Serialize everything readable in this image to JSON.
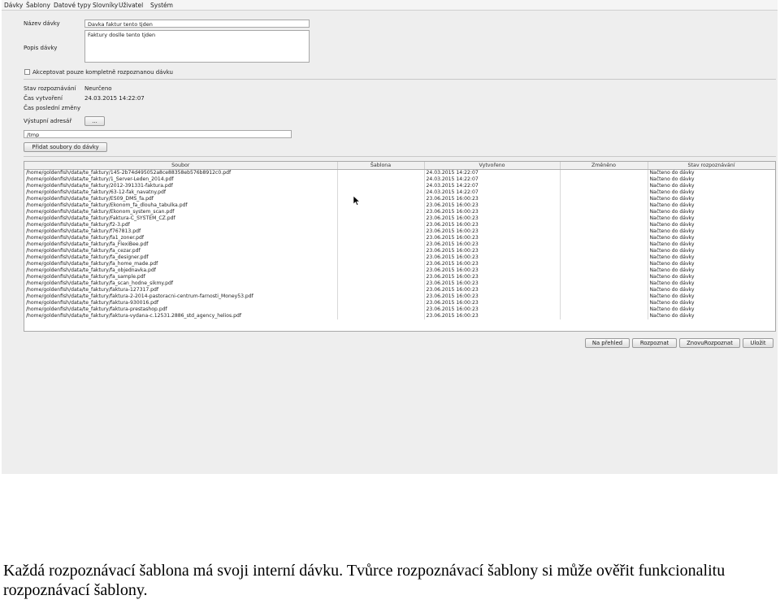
{
  "menu": [
    "Dávky",
    "Šablony",
    "Datové typy",
    "Slovníky",
    "Uživatel",
    "Systém"
  ],
  "form": {
    "name_label": "Název dávky",
    "name_value": "Davka faktur tento tjden",
    "description_label": "Popis dávky",
    "description_value": "Faktury doslle tento tjden",
    "checkbox_label": "Akceptovat pouze kompletně rozpoznanou dávku",
    "status_label": "Stav rozpoznávání",
    "status_value": "Neurčeno",
    "created_label": "Čas vytvoření",
    "created_value": "24.03.2015 14:22:07",
    "modified_label": "Čas poslední změny",
    "modified_value": "",
    "output_label": "Výstupní adresář",
    "browse_label": "...",
    "output_path": "/tmp",
    "add_files_label": "Přidat soubory do dávky"
  },
  "table": {
    "columns": [
      "Soubor",
      "Šablona",
      "Vytvořeno",
      "Změněno",
      "Stav rozpoznávání"
    ],
    "rows": [
      [
        "/home/goldenfish/data/te_faktury/145-2b74d495052a8ce88358eb576b8912c0.pdf",
        "",
        "24.03.2015 14:22:07",
        "",
        "Načteno do dávky"
      ],
      [
        "/home/goldenfish/data/te_faktury/1_Server-Leden_2014.pdf",
        "",
        "24.03.2015 14:22:07",
        "",
        "Načteno do dávky"
      ],
      [
        "/home/goldenfish/data/te_faktury/2012-391331-faktura.pdf",
        "",
        "24.03.2015 14:22:07",
        "",
        "Načteno do dávky"
      ],
      [
        "/home/goldenfish/data/te_faktury/63-12-fak_navatny.pdf",
        "",
        "24.03.2015 14:22:07",
        "",
        "Načteno do dávky"
      ],
      [
        "/home/goldenfish/data/te_faktury/ES09_DMS_fa.pdf",
        "",
        "23.06.2015 16:00:23",
        "",
        "Načteno do dávky"
      ],
      [
        "/home/goldenfish/data/te_faktury/Ekonom_fa_dlouha_tabulka.pdf",
        "",
        "23.06.2015 16:00:23",
        "",
        "Načteno do dávky"
      ],
      [
        "/home/goldenfish/data/te_faktury/Ekonom_system_scan.pdf",
        "",
        "23.06.2015 16:00:23",
        "",
        "Načteno do dávky"
      ],
      [
        "/home/goldenfish/data/te_faktury/Faktura-C_SYSTEM_CZ.pdf",
        "",
        "23.06.2015 16:00:23",
        "",
        "Načteno do dávky"
      ],
      [
        "/home/goldenfish/data/te_faktury/f2-3.pdf",
        "",
        "23.06.2015 16:00:23",
        "",
        "Načteno do dávky"
      ],
      [
        "/home/goldenfish/data/te_faktury/f767813.pdf",
        "",
        "23.06.2015 16:00:23",
        "",
        "Načteno do dávky"
      ],
      [
        "/home/goldenfish/data/te_faktury/fa1_zoner.pdf",
        "",
        "23.06.2015 16:00:23",
        "",
        "Načteno do dávky"
      ],
      [
        "/home/goldenfish/data/te_faktury/fa_FlexiBee.pdf",
        "",
        "23.06.2015 16:00:23",
        "",
        "Načteno do dávky"
      ],
      [
        "/home/goldenfish/data/te_faktury/fa_cezar.pdf",
        "",
        "23.06.2015 16:00:23",
        "",
        "Načteno do dávky"
      ],
      [
        "/home/goldenfish/data/te_faktury/fa_designer.pdf",
        "",
        "23.06.2015 16:00:23",
        "",
        "Načteno do dávky"
      ],
      [
        "/home/goldenfish/data/te_faktury/fa_home_made.pdf",
        "",
        "23.06.2015 16:00:23",
        "",
        "Načteno do dávky"
      ],
      [
        "/home/goldenfish/data/te_faktury/fa_objednavka.pdf",
        "",
        "23.06.2015 16:00:23",
        "",
        "Načteno do dávky"
      ],
      [
        "/home/goldenfish/data/te_faktury/fa_sample.pdf",
        "",
        "23.06.2015 16:00:23",
        "",
        "Načteno do dávky"
      ],
      [
        "/home/goldenfish/data/te_faktury/fa_scan_hodne_sikmy.pdf",
        "",
        "23.06.2015 16:00:23",
        "",
        "Načteno do dávky"
      ],
      [
        "/home/goldenfish/data/te_faktury/faktura-127317.pdf",
        "",
        "23.06.2015 16:00:23",
        "",
        "Načteno do dávky"
      ],
      [
        "/home/goldenfish/data/te_faktury/faktura-2-2014-pastoracni-centrum-farnosti_Money53.pdf",
        "",
        "23.06.2015 16:00:23",
        "",
        "Načteno do dávky"
      ],
      [
        "/home/goldenfish/data/te_faktury/faktura-930016.pdf",
        "",
        "23.06.2015 16:00:23",
        "",
        "Načteno do dávky"
      ],
      [
        "/home/goldenfish/data/te_faktury/faktura-prestashop.pdf",
        "",
        "23.06.2015 16:00:23",
        "",
        "Načteno do dávky"
      ],
      [
        "/home/goldenfish/data/te_faktury/faktura-vydana-c.12531.2886_std_agency_helios.pdf",
        "",
        "23.06.2015 16:00:23",
        "",
        "Načteno do dávky"
      ]
    ]
  },
  "actions": {
    "overview_label": "Na přehled",
    "recognize_label": "Rozpoznat",
    "rerecognize_label": "ZnovuRozpoznat",
    "save_label": "Uložit"
  },
  "caption": "Každá rozpoznávací šablona má svoji interní dávku. Tvůrce rozpoznávací šablony si může ověřit funkcionalitu rozpoznávací šablony.",
  "colors": {
    "window_bg": "#eeeeee",
    "table_bg": "#ffffff"
  }
}
